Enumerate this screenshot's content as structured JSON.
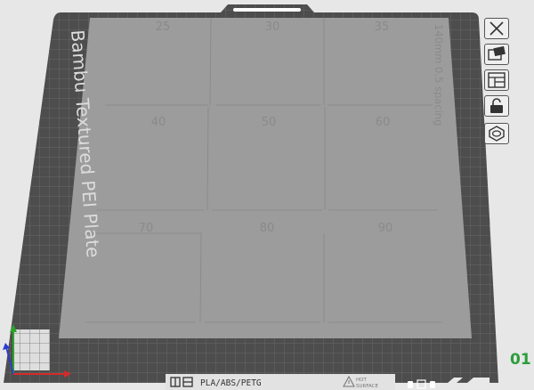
{
  "plate": {
    "name": "Bambu Textured PEI Plate",
    "spacing_label": "140mm 0.5 spacing",
    "filaments": "PLA/ABS/PETG",
    "hot_surface_line1": "HOT",
    "hot_surface_line2": "SURFACE",
    "number": "01"
  },
  "calibration_cells": [
    "25",
    "30",
    "35",
    "40",
    "50",
    "60",
    "70",
    "80",
    "90"
  ],
  "toolbar": [
    {
      "id": "close",
      "icon": "close-icon"
    },
    {
      "id": "orient",
      "icon": "auto-orient-icon"
    },
    {
      "id": "arrange",
      "icon": "arrange-icon"
    },
    {
      "id": "lock",
      "icon": "lock-icon"
    },
    {
      "id": "settings",
      "icon": "plate-settings-icon"
    }
  ],
  "colors": {
    "background": "#e6e7e6",
    "plate": "#4d4d4d",
    "bed_area": "#9c9c9c",
    "grid_line": "#6e6e6e",
    "axis_x": "#d42a2a",
    "axis_y": "#2aa52a",
    "axis_z": "#2a3ad4",
    "plate_number": "#2a9d3a"
  }
}
